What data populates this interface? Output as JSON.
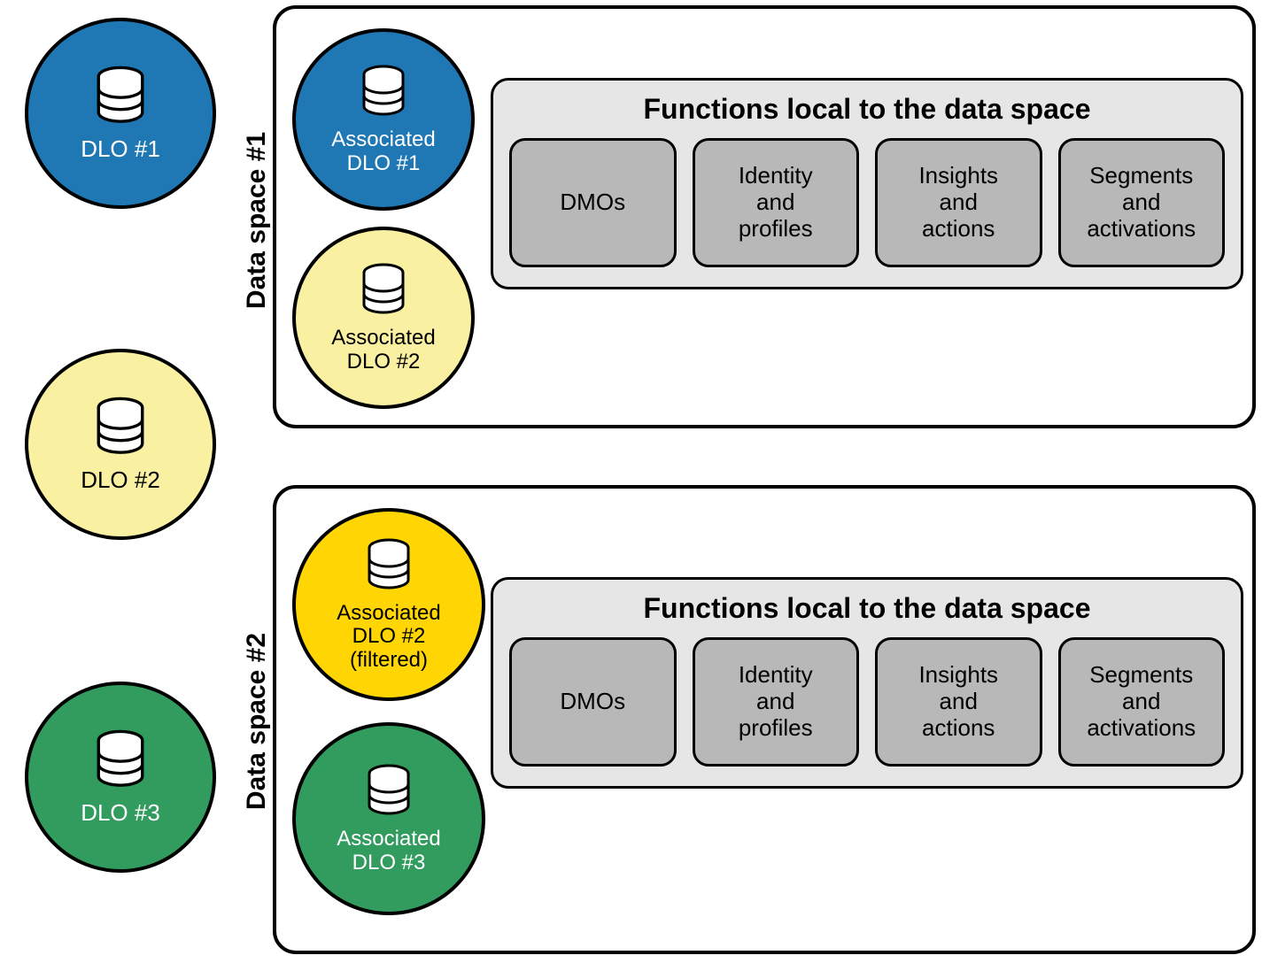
{
  "left_dlos": [
    {
      "label": "DLO #1",
      "color": "blue",
      "text": "white"
    },
    {
      "label": "DLO #2",
      "color": "lightyellow",
      "text": "black"
    },
    {
      "label": "DLO #3",
      "color": "green",
      "text": "white"
    }
  ],
  "dataspaces": [
    {
      "label": "Data space #1",
      "assoc_dlos": [
        {
          "label": "Associated\nDLO #1",
          "color": "blue",
          "text": "white"
        },
        {
          "label": "Associated\nDLO #2",
          "color": "lightyellow",
          "text": "black"
        }
      ],
      "functions_title": "Functions local to the data space",
      "functions": [
        "DMOs",
        "Identity\nand\nprofiles",
        "Insights\nand\nactions",
        "Segments\nand\nactivations"
      ]
    },
    {
      "label": "Data space #2",
      "assoc_dlos": [
        {
          "label": "Associated\nDLO #2\n(filtered)",
          "color": "yellow",
          "text": "black"
        },
        {
          "label": "Associated\nDLO #3",
          "color": "green",
          "text": "white"
        }
      ],
      "functions_title": "Functions local to the data space",
      "functions": [
        "DMOs",
        "Identity\nand\nprofiles",
        "Insights\nand\nactions",
        "Segments\nand\nactivations"
      ]
    }
  ]
}
